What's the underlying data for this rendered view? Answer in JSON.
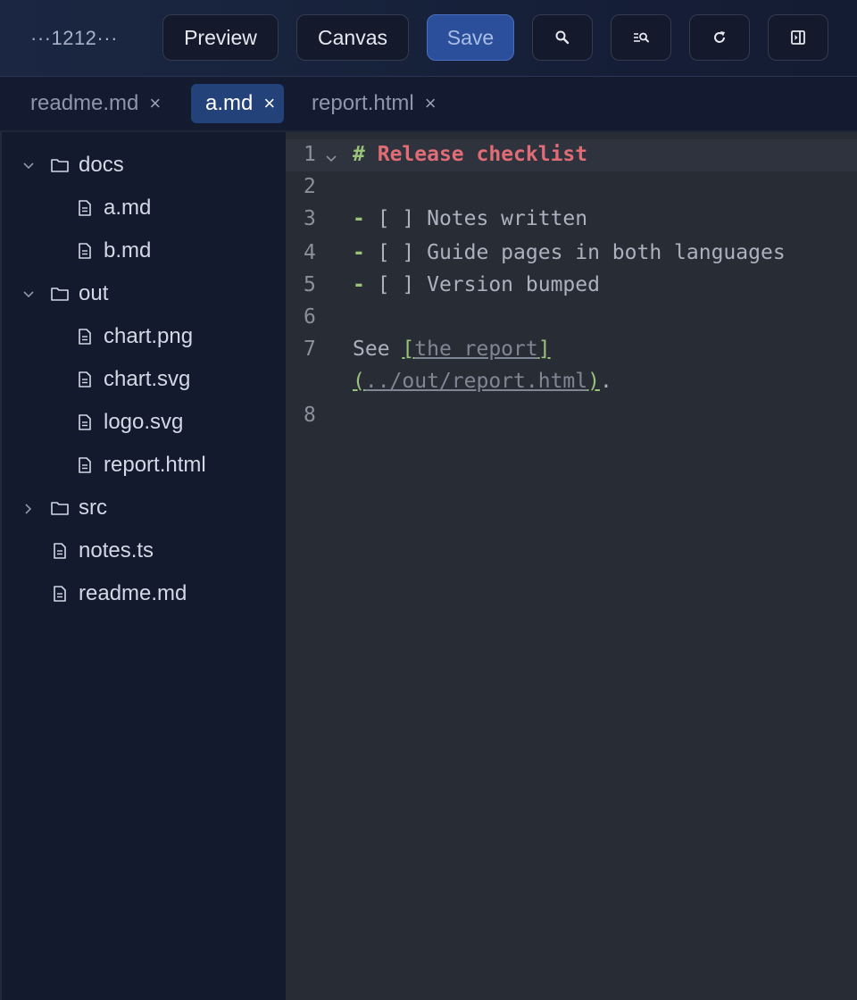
{
  "toolbar": {
    "title": "···1212···",
    "preview_label": "Preview",
    "canvas_label": "Canvas",
    "save_label": "Save",
    "accent_color": "#2b4f9a",
    "icons": [
      "search-icon",
      "search-list-icon",
      "refresh-icon",
      "panel-toggle-icon"
    ]
  },
  "tabs": [
    {
      "label": "readme.md",
      "close": "×",
      "active": false
    },
    {
      "label": "a.md",
      "close": "×",
      "active": true
    },
    {
      "label": "report.html",
      "close": "×",
      "active": false
    }
  ],
  "sidebar": {
    "items": [
      {
        "label": "docs",
        "type": "folder",
        "expanded": true
      },
      {
        "label": "a.md",
        "type": "file"
      },
      {
        "label": "b.md",
        "type": "file"
      },
      {
        "label": "out",
        "type": "folder",
        "expanded": true
      },
      {
        "label": "chart.png",
        "type": "file"
      },
      {
        "label": "chart.svg",
        "type": "file"
      },
      {
        "label": "logo.svg",
        "type": "file"
      },
      {
        "label": "report.html",
        "type": "file"
      },
      {
        "label": "src",
        "type": "folder",
        "expanded": false
      },
      {
        "label": "notes.ts",
        "type": "file"
      },
      {
        "label": "readme.md",
        "type": "file"
      }
    ]
  },
  "editor": {
    "line_numbers": [
      "1",
      "2",
      "3",
      "4",
      "5",
      "6",
      "7",
      "8"
    ],
    "lines": {
      "l1_hash": "#",
      "l1_text": "Release checklist",
      "l3_dash": "-",
      "l3_text": " [ ] Notes written",
      "l4_dash": "-",
      "l4_text": " [ ] Guide pages in both languages",
      "l5_dash": "-",
      "l5_text": " [ ] Version bumped",
      "l7_see": "See ",
      "l7_lbr": "[",
      "l7_linktext": "the report",
      "l7_rbr": "]",
      "l7b_lp": "(",
      "l7b_url": "../out/report.html",
      "l7b_rp": ")",
      "l7b_dot": "."
    }
  }
}
